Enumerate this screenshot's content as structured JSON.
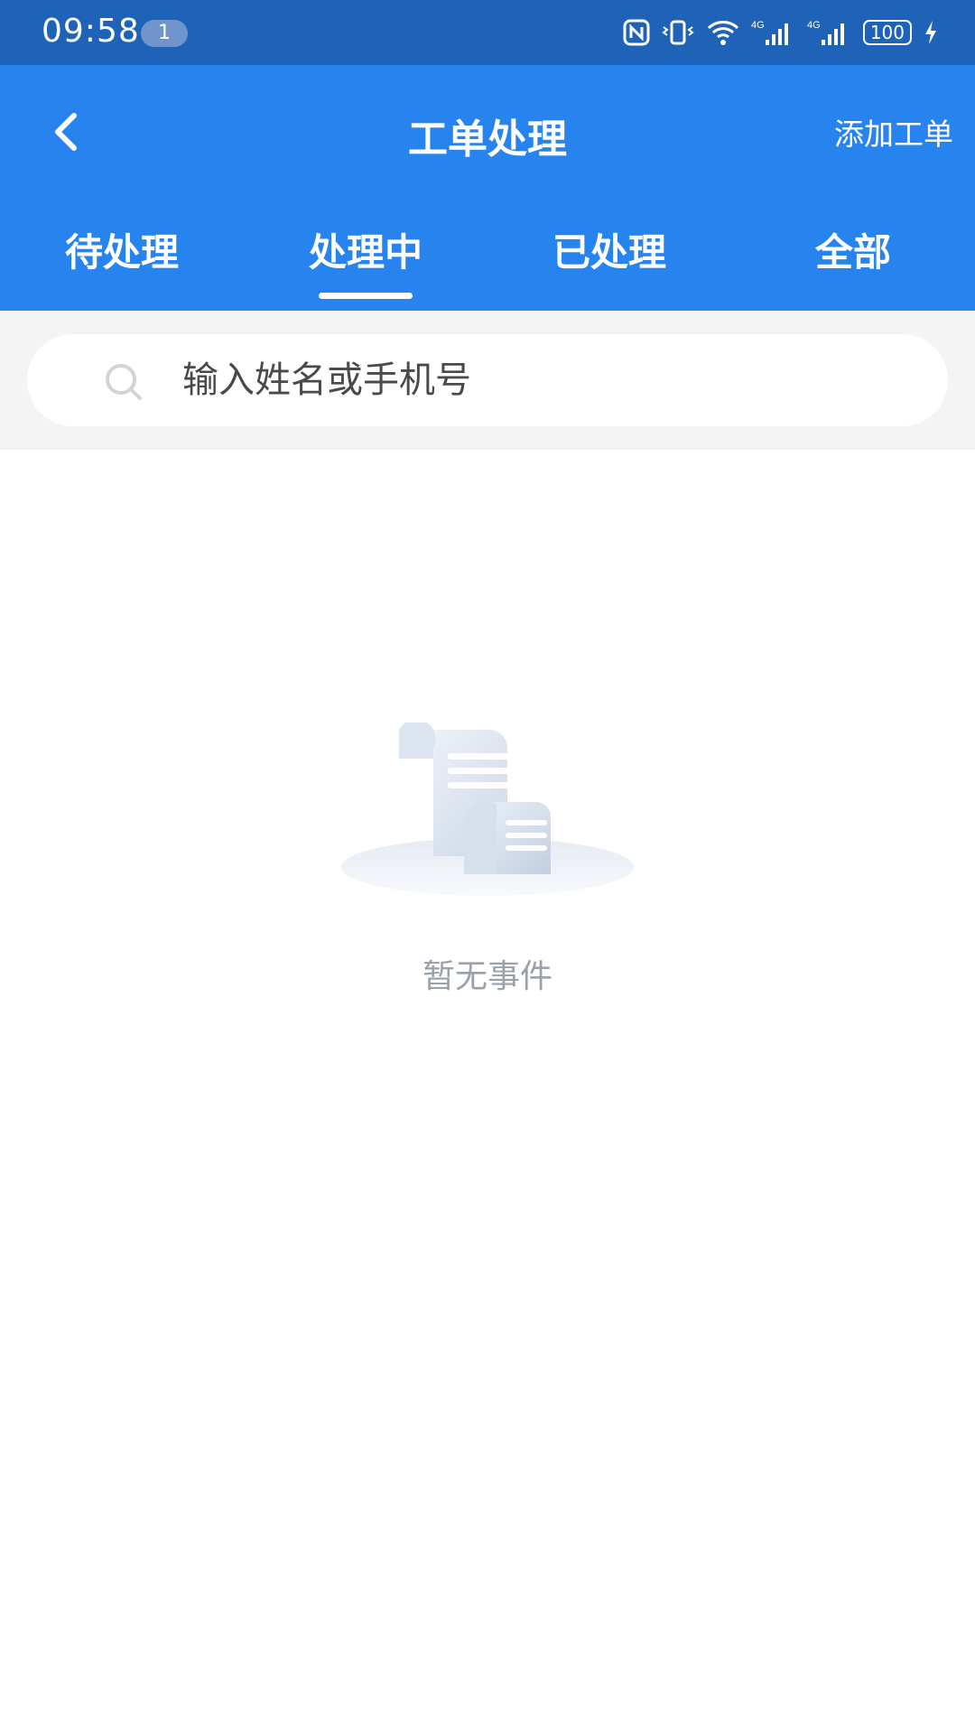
{
  "status_bar": {
    "time": "09:58",
    "notification_count": "1",
    "network_label_1": "4G",
    "network_label_2": "4G",
    "battery": "100",
    "icons": [
      "nfc-icon",
      "vibrate-icon",
      "wifi-icon",
      "signal-icon",
      "signal-icon",
      "battery-icon",
      "charging-icon"
    ]
  },
  "header": {
    "title": "工单处理",
    "add_button_label": "添加工单",
    "back_icon": "chevron-left-icon",
    "background_color": "#2784ee"
  },
  "tabs": [
    {
      "label": "待处理",
      "active": false
    },
    {
      "label": "处理中",
      "active": true
    },
    {
      "label": "已处理",
      "active": false
    },
    {
      "label": "全部",
      "active": false
    }
  ],
  "search": {
    "placeholder": "输入姓名或手机号",
    "value": ""
  },
  "empty_state": {
    "message": "暂无事件"
  }
}
